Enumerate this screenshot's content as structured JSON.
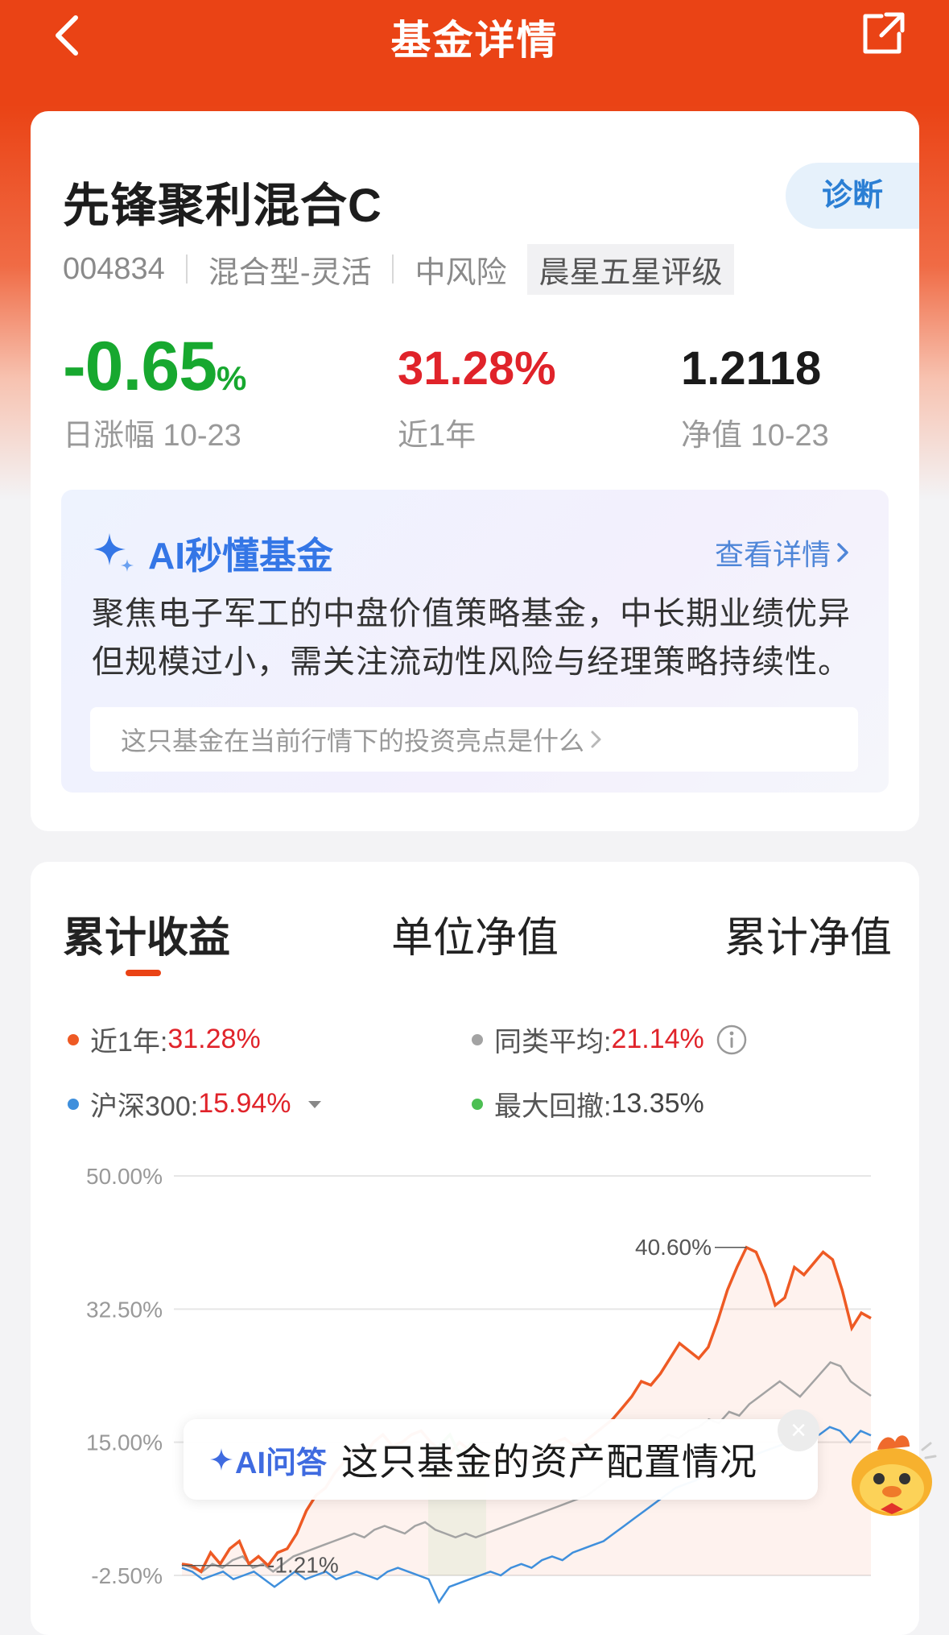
{
  "nav": {
    "title": "基金详情",
    "back_icon": "chevron-left-icon",
    "share_icon": "share-icon"
  },
  "fund": {
    "name": "先锋聚利混合C",
    "diagnose_label": "诊断",
    "code": "004834",
    "type": "混合型-灵活",
    "risk": "中风险",
    "rating": "晨星五星评级"
  },
  "stats": {
    "daily_change": "-0.65",
    "daily_change_unit": "%",
    "daily_label": "日涨幅 10-23",
    "year_return": "31.28%",
    "year_label": "近1年",
    "nav_value": "1.2118",
    "nav_label": "净值 10-23"
  },
  "ai_summary": {
    "title": "AI秒懂基金",
    "more_label": "查看详情",
    "text": "聚焦电子军工的中盘价值策略基金，中长期业绩优异但规模过小，需关注流动性风险与经理策略持续性。",
    "question": "这只基金在当前行情下的投资亮点是什么"
  },
  "tabs": [
    "累计收益",
    "单位净值",
    "累计净值"
  ],
  "legend": {
    "fund_label": "近1年:",
    "fund_value": "31.28%",
    "peer_label": "同类平均:",
    "peer_value": "21.14%",
    "index_label": "沪深300:",
    "index_value": "15.94%",
    "drawdown_label": "最大回撤:",
    "drawdown_value": "13.35%",
    "colors": {
      "fund": "#ee5a24",
      "peer": "#a3a3a3",
      "index": "#3f8fdc",
      "drawdown": "#4cbf53"
    }
  },
  "chart_data": {
    "type": "line",
    "y_ticks": [
      "50.00%",
      "32.50%",
      "15.00%",
      "-2.50%"
    ],
    "ylim": [
      -2.5,
      50
    ],
    "annotations": [
      "40.60%",
      "-1.21%"
    ],
    "series": [
      {
        "name": "近1年",
        "color": "#ee5a24",
        "values": [
          -1,
          -1.2,
          -2,
          0.5,
          -1,
          1,
          2,
          -1,
          0,
          -1.2,
          0.5,
          1,
          3,
          6,
          8,
          9,
          11,
          12.5,
          14,
          13,
          15,
          16,
          14.5,
          15,
          16,
          16.5,
          15,
          14,
          13.5,
          15,
          14,
          13,
          12,
          13,
          12.5,
          13,
          12,
          13.5,
          14,
          15,
          15.5,
          14.5,
          15,
          16,
          17,
          18,
          19.5,
          21,
          23,
          22.5,
          24,
          26,
          28,
          27,
          26,
          27.5,
          31,
          35,
          38,
          40.6,
          40,
          37,
          33,
          34,
          38,
          37,
          38.5,
          40,
          39,
          35,
          30,
          32,
          31.3
        ]
      },
      {
        "name": "同类平均",
        "color": "#a3a3a3",
        "values": [
          -1,
          -1.5,
          -2,
          -1,
          -1.5,
          -0.5,
          0,
          -1.5,
          -1,
          -2,
          -1,
          0,
          0.5,
          1,
          1.5,
          2,
          2.5,
          3,
          2.5,
          3.5,
          4,
          3.5,
          3,
          4,
          4.5,
          3.5,
          3,
          2.5,
          3,
          2.5,
          3,
          3.5,
          4,
          4.5,
          5,
          5.5,
          6,
          6.5,
          7,
          7.5,
          8,
          9,
          10,
          11,
          12,
          13,
          14,
          15,
          16,
          15.5,
          16.5,
          17,
          18,
          17.5,
          19,
          18.5,
          20,
          21,
          22,
          23,
          22,
          21,
          22.5,
          24,
          25.5,
          25,
          23,
          22,
          21.1
        ]
      },
      {
        "name": "沪深300",
        "color": "#3f8fdc",
        "values": [
          -1.5,
          -2,
          -3,
          -2.5,
          -2,
          -3,
          -2.5,
          -2,
          -3,
          -4,
          -3,
          -2,
          -3,
          -2.5,
          -2,
          -3,
          -2.5,
          -2,
          -2.5,
          -3,
          -2,
          -1.5,
          -2,
          -2.5,
          -3,
          -6,
          -4,
          -3.5,
          -3,
          -2.5,
          -2,
          -2.5,
          -1.5,
          -1,
          -1.5,
          -0.5,
          0,
          -0.5,
          0.5,
          1,
          1.5,
          2,
          3,
          4,
          5,
          6,
          7,
          8,
          9,
          9.5,
          10,
          11,
          11.5,
          12,
          12.5,
          13,
          13.5,
          14,
          14.5,
          15,
          14,
          15.5,
          16,
          17,
          16.5,
          15,
          16.5,
          15.9
        ]
      },
      {
        "name": "最大回撤",
        "color": "#4cbf53",
        "values": [
          13,
          14,
          15,
          16,
          14,
          13.5,
          15,
          14,
          13
        ]
      }
    ]
  }
}
